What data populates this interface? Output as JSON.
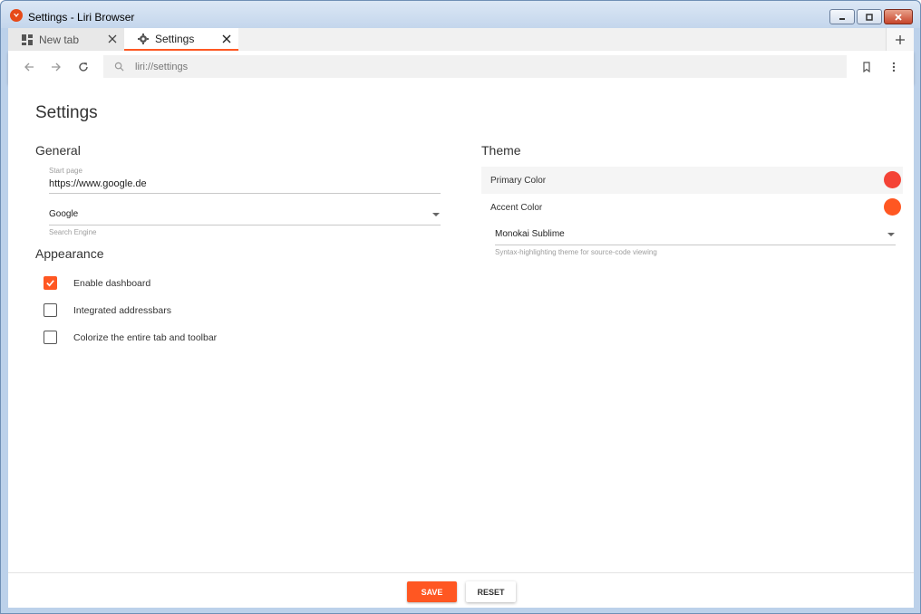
{
  "window": {
    "title": "Settings - Liri Browser"
  },
  "tabs": [
    {
      "label": "New tab",
      "icon": "dashboard-icon",
      "active": false
    },
    {
      "label": "Settings",
      "icon": "gear-icon",
      "active": true
    }
  ],
  "toolbar": {
    "address_value": "liri://settings",
    "new_tab_label": "+"
  },
  "settings": {
    "title": "Settings",
    "general": {
      "heading": "General",
      "start_page_label": "Start page",
      "start_page_value": "https://www.google.de",
      "search_engine_value": "Google",
      "search_engine_label": "Search Engine"
    },
    "appearance": {
      "heading": "Appearance",
      "options": [
        {
          "label": "Enable dashboard",
          "checked": true
        },
        {
          "label": "Integrated addressbars",
          "checked": false
        },
        {
          "label": "Colorize the entire tab and toolbar",
          "checked": false
        }
      ]
    },
    "theme": {
      "heading": "Theme",
      "primary_label": "Primary Color",
      "primary_color": "#f44336",
      "accent_label": "Accent Color",
      "accent_color": "#ff5722",
      "syntax_value": "Monokai Sublime",
      "syntax_label": "Syntax-highlighting theme for source-code viewing"
    }
  },
  "footer": {
    "save_label": "SAVE",
    "reset_label": "RESET"
  }
}
